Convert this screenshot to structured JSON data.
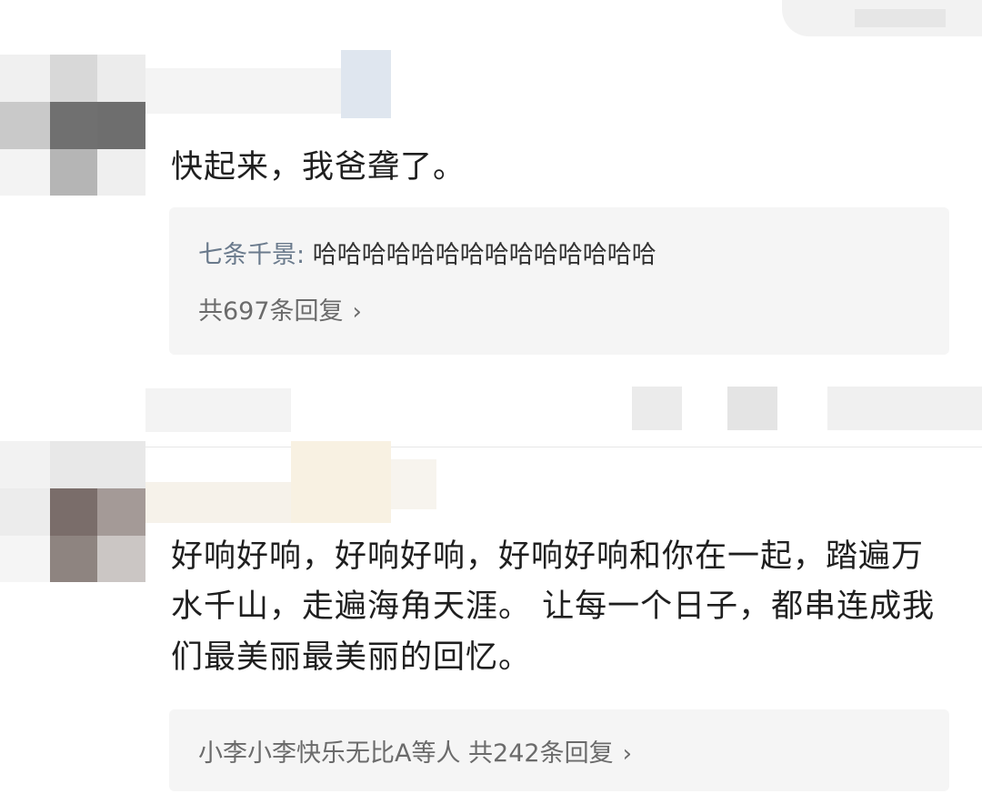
{
  "comments": [
    {
      "text": "快起来，我爸聋了。",
      "reply": {
        "author": "七条千景:",
        "text": " 哈哈哈哈哈哈哈哈哈哈哈哈哈哈"
      },
      "more": "共697条回复"
    },
    {
      "text": "好响好响，好响好响，好响好响和你在一起，踏遍万水千山，走遍海角天涯。 让每一个日子，都串连成我们最美丽最美丽的回忆。",
      "more": "小李小李快乐无比A等人 共242条回复"
    }
  ],
  "icons": {
    "chevron": "chevron-right-icon"
  }
}
